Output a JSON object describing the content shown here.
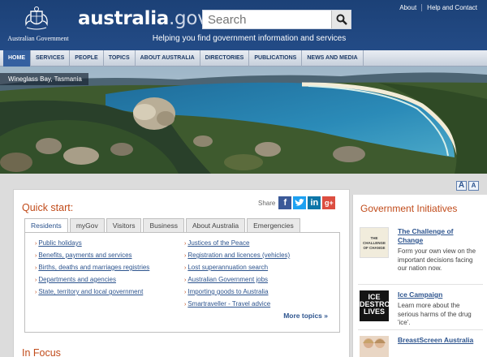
{
  "header": {
    "gov_label": "Australian Government",
    "site_name_bold": "australia",
    "site_name_rest": ".gov.au",
    "tagline": "Helping you find government information and services",
    "search_placeholder": "Search",
    "top_links": [
      "About",
      "Help and Contact"
    ]
  },
  "nav": [
    "HOME",
    "SERVICES",
    "PEOPLE",
    "TOPICS",
    "ABOUT AUSTRALIA",
    "DIRECTORIES",
    "PUBLICATIONS",
    "NEWS AND MEDIA"
  ],
  "hero": {
    "caption": "Wineglass Bay, Tasmania"
  },
  "font_controls": [
    "A",
    "A"
  ],
  "quick_start": {
    "title": "Quick start:",
    "share_label": "Share",
    "share_icons": [
      "facebook-icon",
      "twitter-icon",
      "linkedin-icon",
      "googleplus-icon"
    ],
    "tabs": [
      "Residents",
      "myGov",
      "Visitors",
      "Business",
      "About Australia",
      "Emergencies"
    ],
    "active_tab": "Residents",
    "links_col1": [
      "Public holidays",
      "Benefits, payments and services",
      "Births, deaths and marriages registries",
      "Departments and agencies",
      "State, territory and local government"
    ],
    "links_col2": [
      "Justices of the Peace",
      "Registration and licences (vehicles)",
      "Lost superannuation search",
      "Australian Government jobs",
      "Importing goods to Australia",
      "Smartraveller - Travel advice"
    ],
    "more_topics": "More topics »"
  },
  "in_focus": {
    "title": "In Focus"
  },
  "initiatives": {
    "title": "Government Initiatives",
    "items": [
      {
        "title": "The Challenge of Change",
        "desc": "Form your own view on the important decisions facing our nation now.",
        "thumb_text": "THE CHALLENGE OF CHANGE"
      },
      {
        "title": "Ice Campaign",
        "desc": "Learn more about the serious harms of the drug 'ice'.",
        "thumb_text": "ICE DESTROYS LIVES"
      },
      {
        "title": "BreastScreen Australia",
        "desc": ""
      }
    ]
  },
  "colors": {
    "header_blue": "#1c4177",
    "accent_orange": "#c14b1a",
    "link_blue": "#2d548e"
  }
}
